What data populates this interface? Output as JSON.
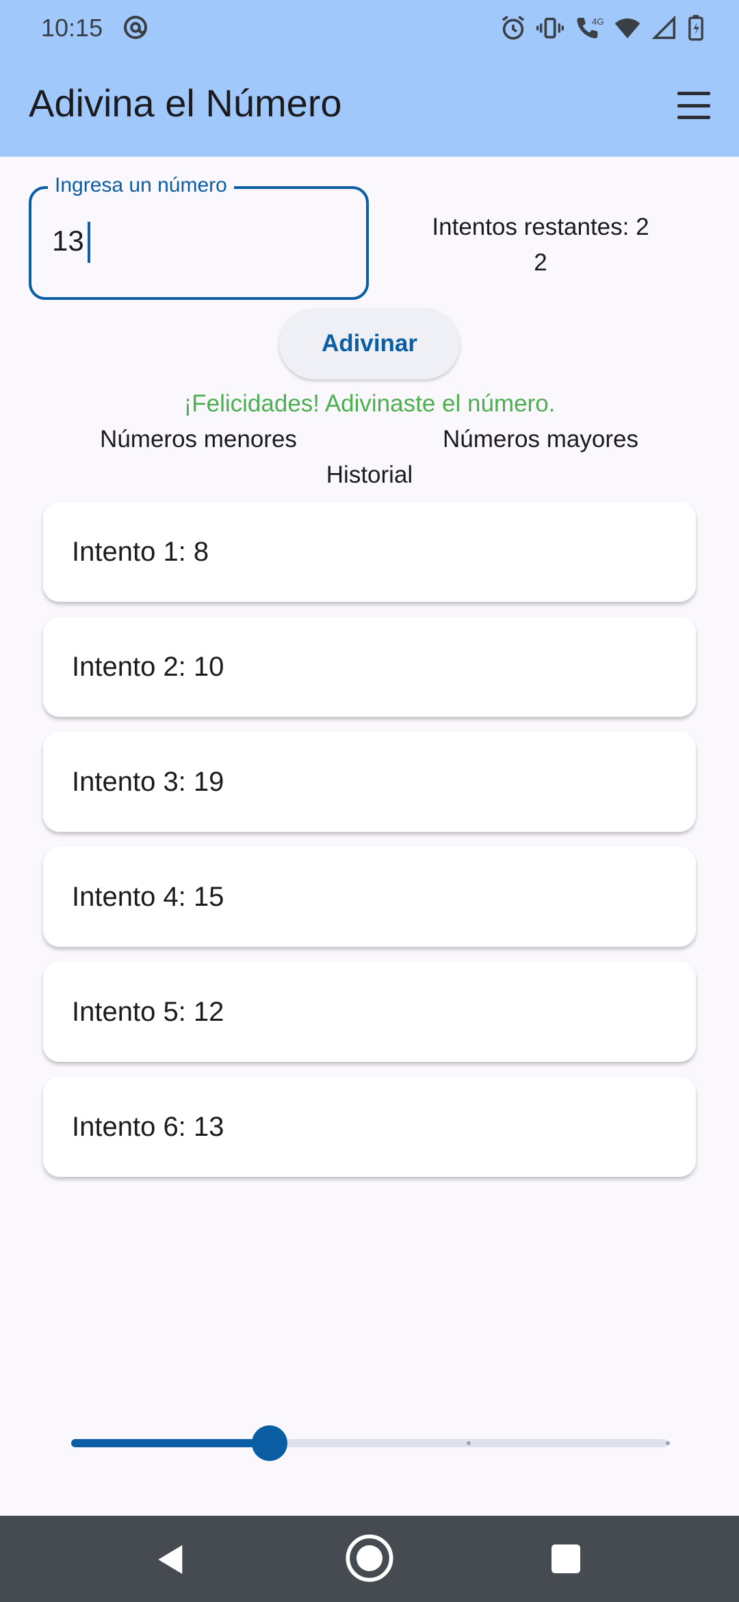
{
  "status_bar": {
    "time": "10:15",
    "left_icon": "at-sign-icon",
    "right_icons": [
      "alarm-icon",
      "vibrate-icon",
      "volte-call-icon",
      "wifi-icon",
      "signal-icon",
      "battery-charging-icon"
    ],
    "network_label": "4G"
  },
  "app_bar": {
    "title": "Adivina el Número",
    "menu_icon": "menu-icon"
  },
  "input": {
    "label": "Ingresa un número",
    "value": "13"
  },
  "remaining": {
    "text": "Intentos restantes: 2",
    "value": "2"
  },
  "guess_button": {
    "label": "Adivinar"
  },
  "result_message": "¡Felicidades! Adivinaste el número.",
  "lower_numbers_label": "Números menores",
  "higher_numbers_label": "Números mayores",
  "history_label": "Historial",
  "history": [
    "Intento 1: 8",
    "Intento 2: 10",
    "Intento 3: 19",
    "Intento 4: 15",
    "Intento 5: 12",
    "Intento 6: 13"
  ],
  "difficulty_slider": {
    "value_fraction": 0.333,
    "steps": 4
  },
  "colors": {
    "app_bar": "#a0c8fb",
    "primary": "#0b5ea3",
    "success": "#4caf50",
    "background": "#fbf8fd",
    "nav_bar": "#454b51"
  },
  "nav_bar": {
    "icons": [
      "back-icon",
      "home-icon",
      "recents-icon"
    ]
  }
}
